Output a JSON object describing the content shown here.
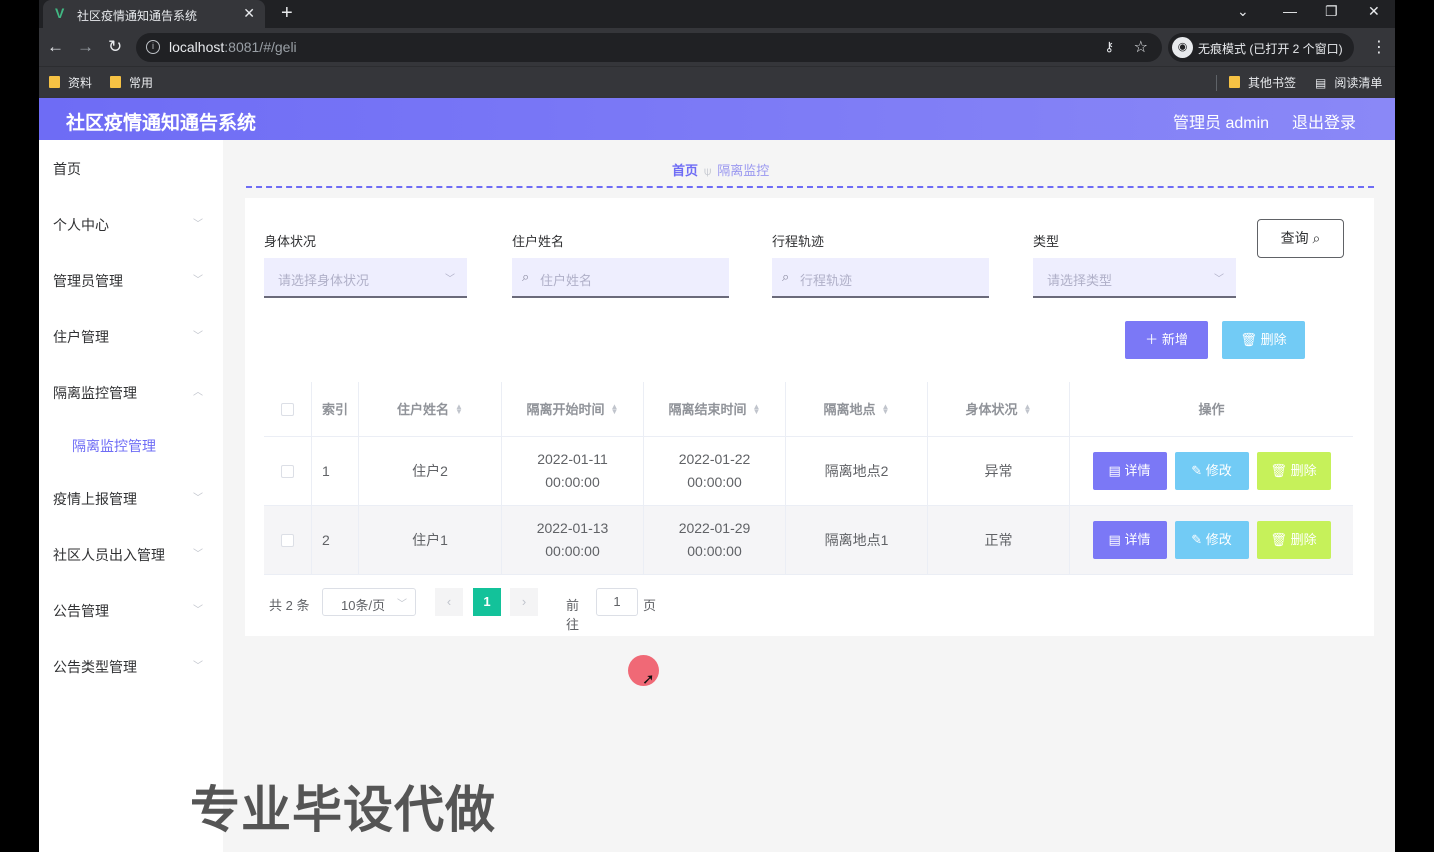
{
  "browser": {
    "tab_title": "社区疫情通知通告系统",
    "url_host": "localhost",
    "url_rest": ":8081/#/geli",
    "incognito_label": "无痕模式 (已打开 2 个窗口)",
    "bookmarks": [
      "资料",
      "常用"
    ],
    "other_bookmarks": "其他书签",
    "reading_list": "阅读清单"
  },
  "header": {
    "title": "社区疫情通知通告系统",
    "user": "管理员 admin",
    "logout": "退出登录"
  },
  "sidebar": {
    "items": [
      {
        "label": "首页"
      },
      {
        "label": "个人中心"
      },
      {
        "label": "管理员管理"
      },
      {
        "label": "住户管理"
      },
      {
        "label": "隔离监控管理"
      },
      {
        "label": "隔离监控管理"
      },
      {
        "label": "疫情上报管理"
      },
      {
        "label": "社区人员出入管理"
      },
      {
        "label": "公告管理"
      },
      {
        "label": "公告类型管理"
      }
    ]
  },
  "breadcrumb": {
    "home": "首页",
    "current": "隔离监控"
  },
  "filters": {
    "health": {
      "label": "身体状况",
      "placeholder": "请选择身体状况"
    },
    "name": {
      "label": "住户姓名",
      "placeholder": "住户姓名"
    },
    "track": {
      "label": "行程轨迹",
      "placeholder": "行程轨迹"
    },
    "type": {
      "label": "类型",
      "placeholder": "请选择类型"
    },
    "query": "查询"
  },
  "actions": {
    "add": "新增",
    "delete": "删除"
  },
  "table": {
    "columns": [
      "索引",
      "住户姓名",
      "隔离开始时间",
      "隔离结束时间",
      "隔离地点",
      "身体状况",
      "操作"
    ],
    "rows": [
      {
        "index": "1",
        "name": "住户2",
        "start": "2022-01-11 00:00:00",
        "end": "2022-01-22 00:00:00",
        "place": "隔离地点2",
        "health": "异常"
      },
      {
        "index": "2",
        "name": "住户1",
        "start": "2022-01-13 00:00:00",
        "end": "2022-01-29 00:00:00",
        "place": "隔离地点1",
        "health": "正常"
      }
    ],
    "ops": {
      "detail": "详情",
      "edit": "修改",
      "remove": "删除"
    }
  },
  "pagination": {
    "total": "共 2 条",
    "page_size": "10条/页",
    "current_page": "1",
    "goto_prefix": "前往",
    "goto_value": "1",
    "goto_suffix": "页"
  },
  "watermark": "专业毕设代做"
}
